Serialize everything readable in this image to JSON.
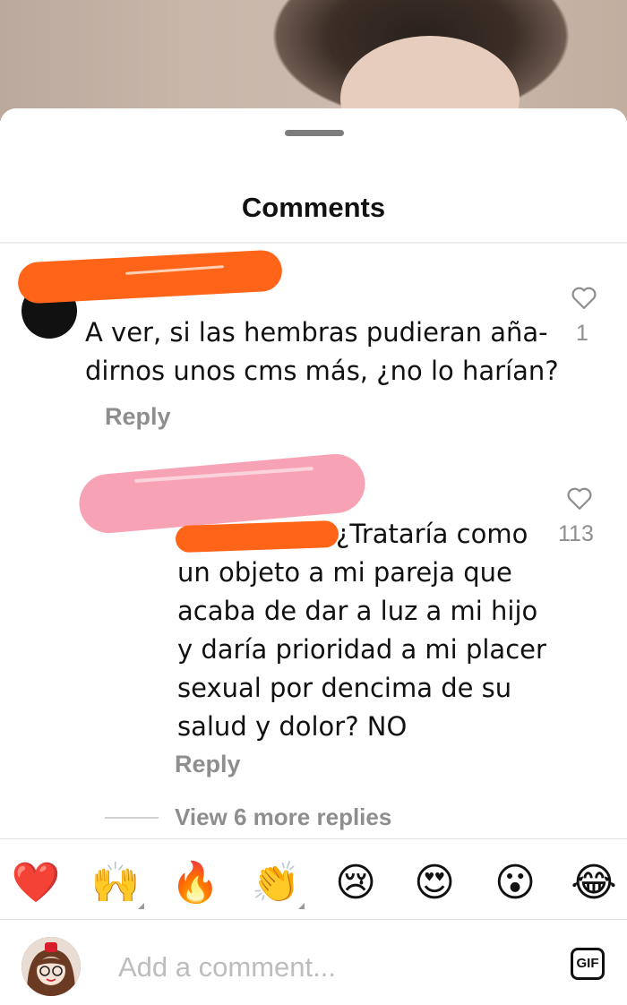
{
  "sheet": {
    "title": "Comments"
  },
  "comments": [
    {
      "text": "A ver, si las hembras pudieran aña-\ndirnos unos cms más, ¿no lo harían?",
      "reply_label": "Reply",
      "likes": "1"
    },
    {
      "text": "¿Trataría como\nun objeto a mi pareja que\nacaba de dar a luz a mi hijo\ny daría prioridad a mi placer\nsexual por dencima de su\nsalud y dolor? NO",
      "reply_label": "Reply",
      "likes": "113",
      "view_more": "View 6 more replies"
    }
  ],
  "reactions": [
    {
      "icon": "red-heart-emoji",
      "glyph": "❤️"
    },
    {
      "icon": "raising-hands-emoji",
      "glyph": "🙌"
    },
    {
      "icon": "fire-emoji",
      "glyph": "🔥"
    },
    {
      "icon": "clapping-hands-emoji",
      "glyph": "👏"
    },
    {
      "icon": "crying-face-emoji",
      "glyph": "😢"
    },
    {
      "icon": "heart-eyes-emoji",
      "glyph": "😍"
    },
    {
      "icon": "surprised-face-emoji",
      "glyph": "😮"
    },
    {
      "icon": "tears-of-joy-emoji",
      "glyph": "😂"
    }
  ],
  "composer": {
    "placeholder": "Add a comment...",
    "gif_label": "GIF"
  },
  "colors": {
    "redaction_orange": "#ff6418",
    "redaction_pink": "#f7a3b5",
    "muted": "#8e8e8e"
  }
}
